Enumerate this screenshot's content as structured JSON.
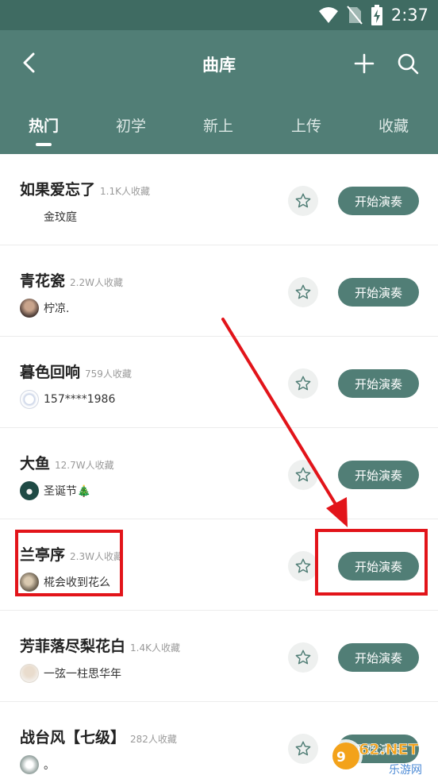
{
  "status_bar": {
    "time": "2:37"
  },
  "header": {
    "title": "曲库"
  },
  "tabs": [
    {
      "label": "热门",
      "active": true
    },
    {
      "label": "初学",
      "active": false
    },
    {
      "label": "新上",
      "active": false
    },
    {
      "label": "上传",
      "active": false
    },
    {
      "label": "收藏",
      "active": false
    }
  ],
  "songs": [
    {
      "title": "如果爱忘了",
      "favorites": "1.1K人收藏",
      "user": "金玟庭",
      "avatar": "none",
      "play_label": "开始演奏"
    },
    {
      "title": "青花瓷",
      "favorites": "2.2W人收藏",
      "user": "柠凉.",
      "avatar": "photo-dark",
      "play_label": "开始演奏"
    },
    {
      "title": "暮色回响",
      "favorites": "759人收藏",
      "user": "157****1986",
      "avatar": "default-light",
      "play_label": "开始演奏"
    },
    {
      "title": "大鱼",
      "favorites": "12.7W人收藏",
      "user": "圣诞节🎄",
      "avatar": "christmas-green",
      "play_label": "开始演奏"
    },
    {
      "title": "兰亭序",
      "favorites": "2.3W人收藏",
      "user": "椛会收到花么",
      "avatar": "photo-brown",
      "play_label": "开始演奏"
    },
    {
      "title": "芳菲落尽梨花白",
      "favorites": "1.4K人收藏",
      "user": "一弦一柱思华年",
      "avatar": "photo-light",
      "play_label": "开始演奏"
    },
    {
      "title": "战台风【七级】",
      "favorites": "282人收藏",
      "user": "。",
      "avatar": "photo-grey",
      "play_label": "开始演奏"
    }
  ],
  "watermark": {
    "text": "962.NET",
    "sub": "乐游网"
  },
  "colors": {
    "header": "#517e76",
    "statusbar": "#3f6b62",
    "button": "#517e76",
    "annotation": "#e2141a"
  }
}
